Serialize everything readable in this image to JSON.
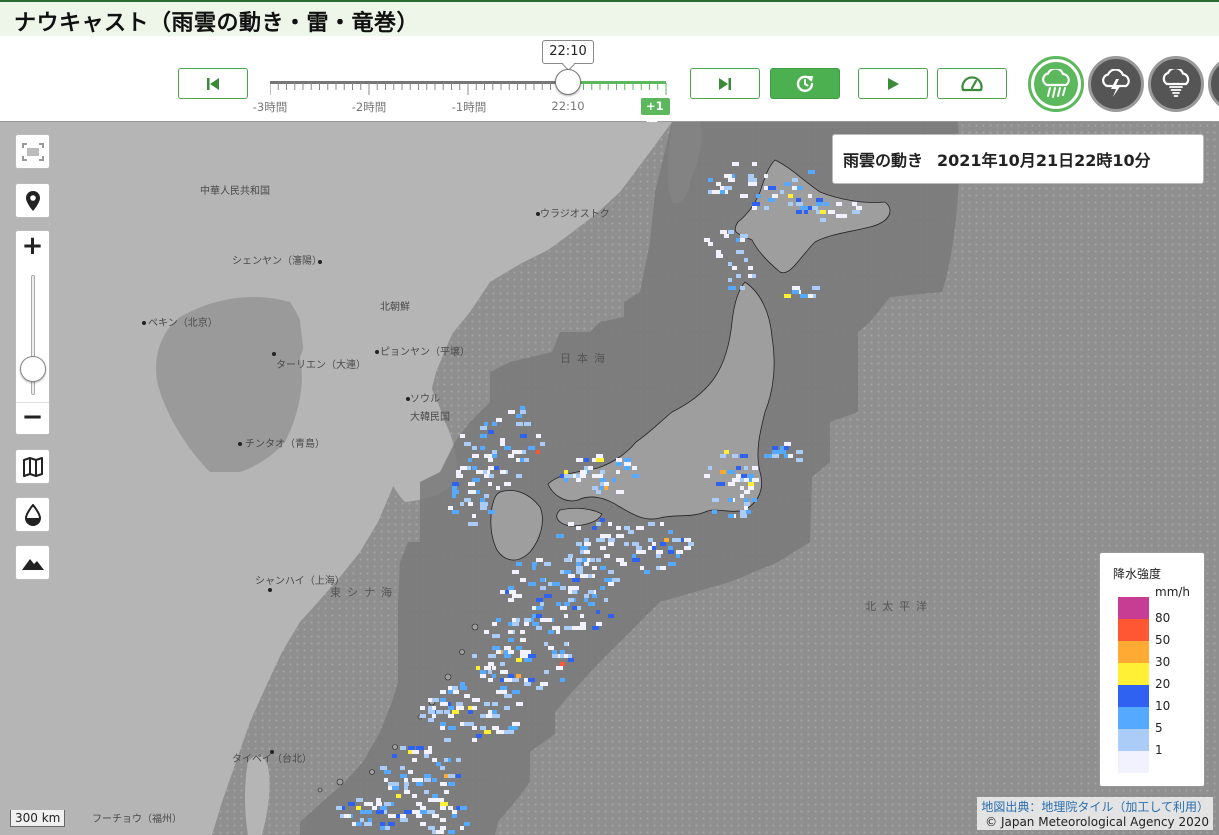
{
  "header": {
    "title": "ナウキャスト（雨雲の動き・雷・竜巻）"
  },
  "controls": {
    "current_time": "22:10",
    "slider_labels": [
      "-3時間",
      "-2時間",
      "-1時間",
      "22:10"
    ],
    "future_label": "+1時間",
    "buttons": [
      "skip-to-start",
      "skip-to-end",
      "refresh",
      "play",
      "speed"
    ],
    "modes": [
      "rain",
      "thunder",
      "tornado"
    ]
  },
  "map": {
    "caption_title": "雨雲の動き",
    "caption_datetime": "2021年10月21日22時10分",
    "place_labels": {
      "china": "中華人民共和国",
      "vladivostok": "ウラジオストク",
      "shenyang": "シェンヤン（瀋陽）",
      "north_korea": "北朝鮮",
      "beijing": "ペキン（北京）",
      "dalian": "ターリエン（大連）",
      "pyongyang": "ピョンヤン（平壌）",
      "seoul": "ソウル",
      "south_korea": "大韓民国",
      "qingdao": "チンタオ（青島）",
      "shanghai": "シャンハイ（上海）",
      "sea_of_japan": "日本海",
      "east_china_sea": "東シナ海",
      "north_pacific": "北太平洋",
      "taipei": "タイペイ（台北）",
      "fuzhou": "フーチョウ（福州）"
    },
    "legend": {
      "title": "降水強度",
      "unit": "mm/h",
      "items": [
        {
          "label": "80",
          "color": "#c63d93"
        },
        {
          "label": "50",
          "color": "#ff5733"
        },
        {
          "label": "30",
          "color": "#ffaa33"
        },
        {
          "label": "20",
          "color": "#fff035"
        },
        {
          "label": "10",
          "color": "#2f62f0"
        },
        {
          "label": "5",
          "color": "#55aaff"
        },
        {
          "label": "1",
          "color": "#aaccf7"
        },
        {
          "label": "",
          "color": "#f2f2ff"
        }
      ]
    },
    "scale_text": "300 km",
    "attribution_link": "地図出典：地理院タイル（加工して利用）",
    "attribution_copy": "© Japan Meteorological Agency 2020"
  },
  "colors": {
    "accent": "#4caf50",
    "title_bg": "#eef6ea",
    "map_land": "#b3b3b3",
    "map_sea": "#8f8f8f",
    "radar_area": "#7a7a7a"
  }
}
